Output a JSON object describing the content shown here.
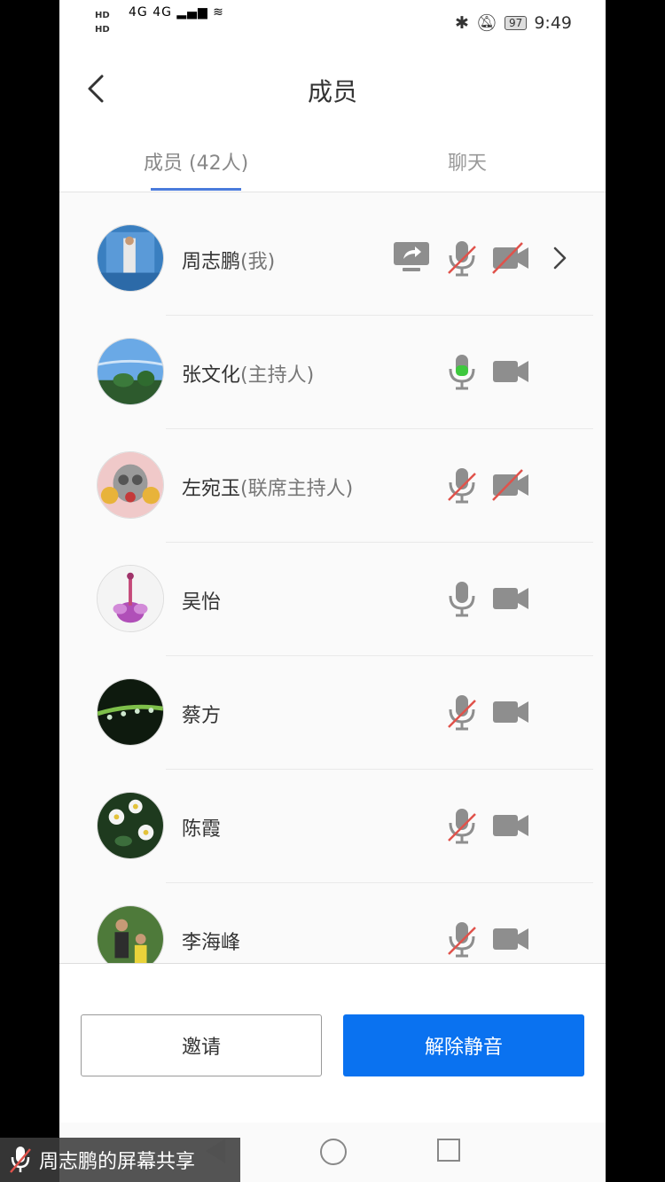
{
  "status_bar": {
    "hd1": "HD",
    "hd2": "HD",
    "network": "4G 4G",
    "battery": "97",
    "time": "9:49"
  },
  "header": {
    "title": "成员"
  },
  "tabs": [
    {
      "label": "成员 (42人)"
    },
    {
      "label": "聊天"
    }
  ],
  "members": [
    {
      "name": "周志鹏",
      "role": "(我)",
      "sharing": true,
      "mic": "muted",
      "camera": "off",
      "chevron": true
    },
    {
      "name": "张文化",
      "role": "(主持人)",
      "sharing": false,
      "mic": "active",
      "camera": "on",
      "chevron": false
    },
    {
      "name": "左宛玉",
      "role": "(联席主持人)",
      "sharing": false,
      "mic": "muted",
      "camera": "off",
      "chevron": false
    },
    {
      "name": "吴怡",
      "role": "",
      "sharing": false,
      "mic": "on",
      "camera": "on",
      "chevron": false
    },
    {
      "name": "蔡方",
      "role": "",
      "sharing": false,
      "mic": "muted",
      "camera": "on",
      "chevron": false
    },
    {
      "name": "陈霞",
      "role": "",
      "sharing": false,
      "mic": "muted",
      "camera": "on",
      "chevron": false
    },
    {
      "name": "李海峰",
      "role": "",
      "sharing": false,
      "mic": "muted",
      "camera": "on",
      "chevron": false
    }
  ],
  "buttons": {
    "invite": "邀请",
    "unmute": "解除静音"
  },
  "share_banner": "周志鹏的屏幕共享",
  "colors": {
    "accent": "#0a72f0",
    "tab_underline": "#4a7bdc",
    "mic_active": "#3ec83e",
    "muted_slash": "#e0524b",
    "icon_gray": "#8e8e8e"
  }
}
